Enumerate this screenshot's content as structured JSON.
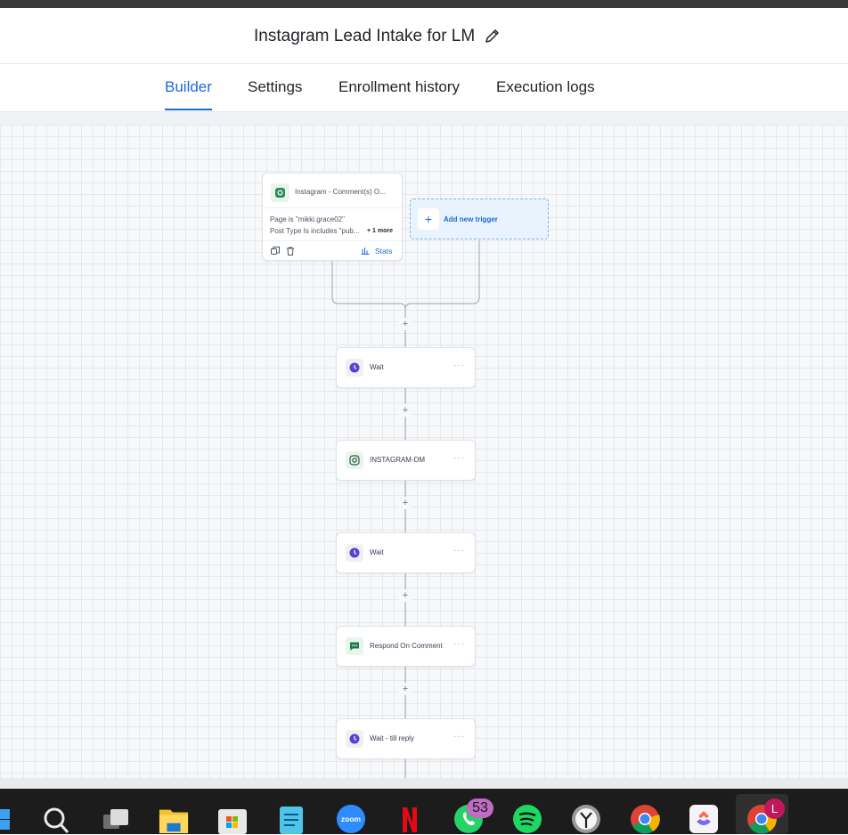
{
  "header": {
    "title": "Instagram Lead Intake for LM"
  },
  "tabs": [
    {
      "label": "Builder",
      "active": true
    },
    {
      "label": "Settings",
      "active": false
    },
    {
      "label": "Enrollment history",
      "active": false
    },
    {
      "label": "Execution logs",
      "active": false
    }
  ],
  "trigger": {
    "title": "Instagram - Comment(s) O...",
    "condition1": "Page is \"mikki.grace02\"",
    "condition2": "Post Type Is includes \"pub...",
    "more": "+ 1 more",
    "stats_label": "Stats"
  },
  "add_trigger": {
    "label": "Add new trigger"
  },
  "nodes": [
    {
      "label": "Wait",
      "icon": "clock-icon"
    },
    {
      "label": "INSTAGRAM-DM",
      "icon": "instagram-icon"
    },
    {
      "label": "Wait",
      "icon": "clock-icon"
    },
    {
      "label": "Respond On Comment",
      "icon": "chat-icon"
    },
    {
      "label": "Wait - till reply",
      "icon": "clock-icon"
    }
  ],
  "taskbar": {
    "whatsapp_badge": "53",
    "chrome_profile_badge": "L"
  },
  "colors": {
    "accent": "#1d6ad3",
    "clock_purple": "#5b3fd6",
    "instagram_green": "#2e8b57"
  }
}
